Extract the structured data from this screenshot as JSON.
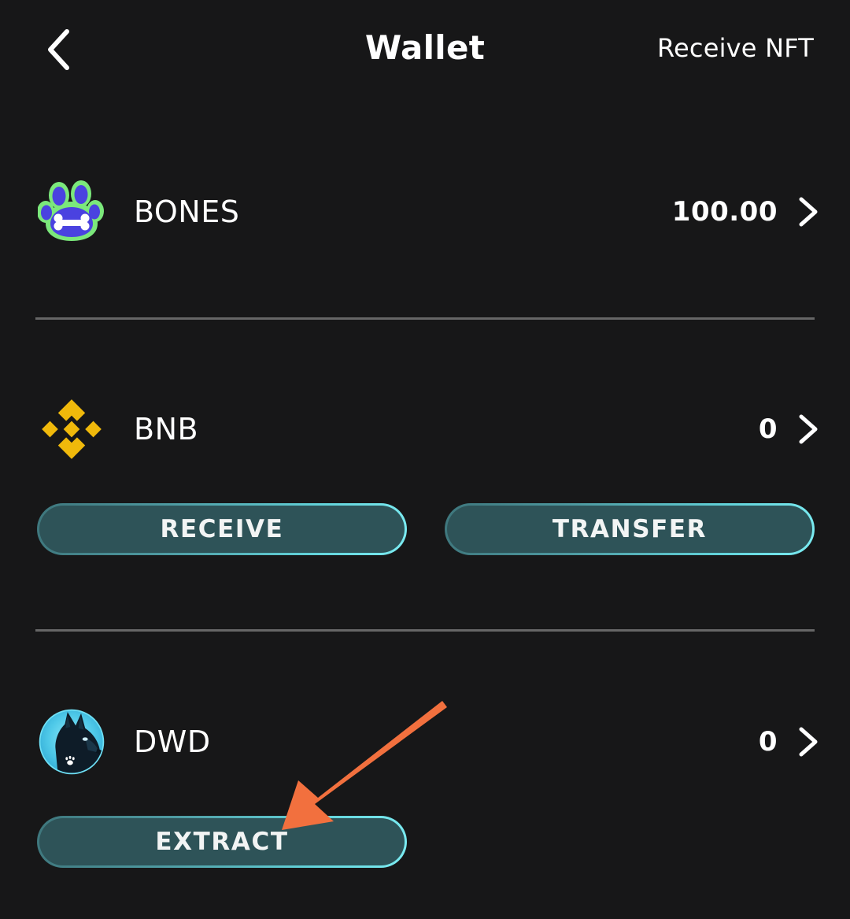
{
  "header": {
    "back_icon": "chevron-left-icon",
    "title": "Wallet",
    "action_label": "Receive NFT"
  },
  "theme": {
    "background": "#171718",
    "text_primary": "#ffffff",
    "divider": "#666666",
    "button_fill": "#2E5358",
    "button_border_start": "#3E767C",
    "button_border_end": "#7BECF2",
    "annotation_arrow": "#F2703E",
    "bones_green": "#7BE87B",
    "bones_purple": "#4A42E0",
    "bnb_gold": "#F0B90B",
    "dwd_cyan": "#5FD8F0"
  },
  "tokens": [
    {
      "symbol": "BONES",
      "balance": "100.00",
      "icon": "paw-bone-icon",
      "chevron": "chevron-right-icon",
      "actions": []
    },
    {
      "symbol": "BNB",
      "balance": "0",
      "icon": "binance-icon",
      "chevron": "chevron-right-icon",
      "actions": [
        "RECEIVE",
        "TRANSFER"
      ]
    },
    {
      "symbol": "DWD",
      "balance": "0",
      "icon": "dog-head-icon",
      "chevron": "chevron-right-icon",
      "actions": [
        "EXTRACT"
      ]
    }
  ],
  "buttons": {
    "receive": "RECEIVE",
    "transfer": "TRANSFER",
    "extract": "EXTRACT"
  },
  "annotation": {
    "type": "arrow",
    "points_to": "EXTRACT",
    "color": "#F2703E"
  }
}
